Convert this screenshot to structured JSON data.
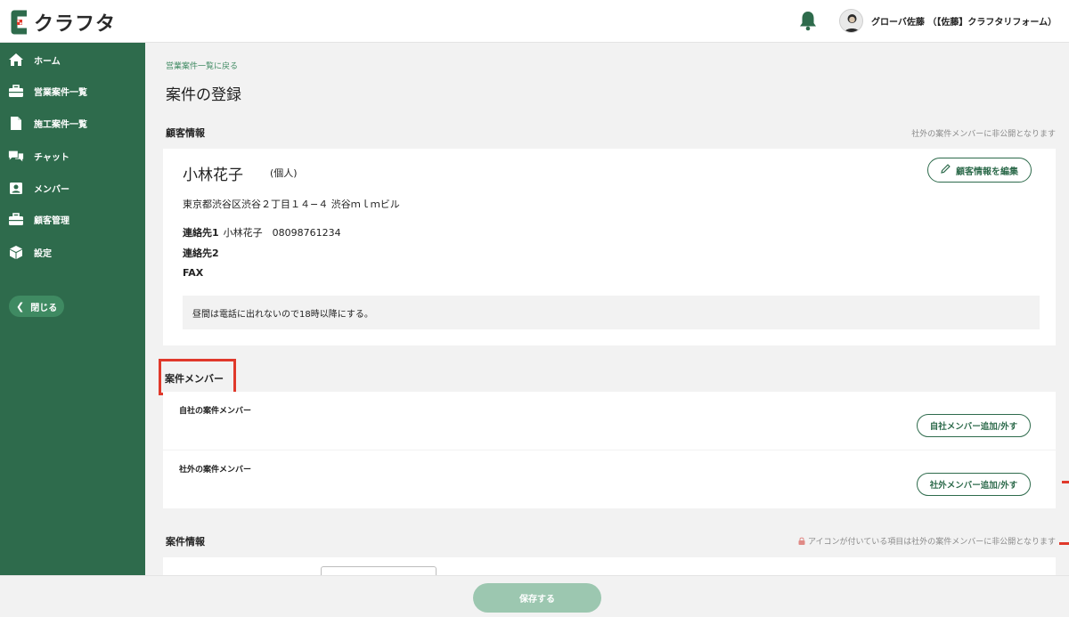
{
  "header": {
    "logo_text": "クラフタ",
    "user_name": "グローバ佐藤 （【佐藤】クラフタリフォーム）"
  },
  "sidebar": {
    "items": [
      {
        "label": "ホーム",
        "icon": "home-icon"
      },
      {
        "label": "営業案件一覧",
        "icon": "briefcase-icon"
      },
      {
        "label": "施工案件一覧",
        "icon": "document-icon"
      },
      {
        "label": "チャット",
        "icon": "chat-icon"
      },
      {
        "label": "メンバー",
        "icon": "member-icon"
      },
      {
        "label": "顧客管理",
        "icon": "briefcase-icon"
      },
      {
        "label": "設定",
        "icon": "box-icon"
      }
    ],
    "close_label": "閉じる"
  },
  "main": {
    "back_link": "営業案件一覧に戻る",
    "page_title": "案件の登録",
    "customer_section": {
      "title": "顧客情報",
      "note": "社外の案件メンバーに非公開となります",
      "name": "小林花子",
      "type": "(個人)",
      "edit_label": "顧客情報を編集",
      "address": "東京都渋谷区渋谷２丁目１４−４ 渋谷ｍｌｍビル",
      "contact1_label": "連絡先1",
      "contact1_value": "小林花子　08098761234",
      "contact2_label": "連絡先2",
      "fax_label": "FAX",
      "memo": "昼間は電話に出れないので18時以降にする。"
    },
    "members_section": {
      "title": "案件メンバー",
      "internal_label": "自社の案件メンバー",
      "internal_button": "自社メンバー追加/外す",
      "external_label": "社外の案件メンバー",
      "external_button": "社外メンバー追加/外す"
    },
    "info_section": {
      "title": "案件情報",
      "note": "アイコンが付いている項目は社外の案件メンバーに非公開となります"
    }
  },
  "footer": {
    "save_label": "保存する"
  },
  "colors": {
    "brand_green": "#2e6b4c",
    "accent_green": "#3f8a62",
    "highlight_red": "#e0392b",
    "save_disabled": "#9cc7b0"
  }
}
